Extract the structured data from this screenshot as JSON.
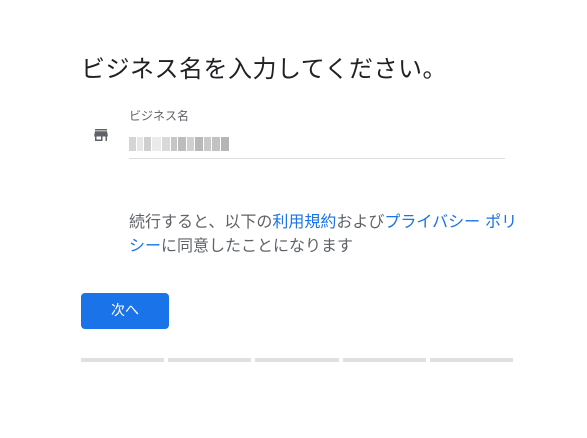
{
  "page": {
    "title": "ビジネス名を入力してください。"
  },
  "business_name_field": {
    "label": "ビジネス名",
    "icon": "store-icon"
  },
  "terms": {
    "prefix": "続行すると、以下の",
    "terms_link": "利用規約",
    "middle": "および",
    "privacy_link": "プライバシー ポリシー",
    "suffix": "に同意したことになります"
  },
  "actions": {
    "next_label": "次へ"
  },
  "progress": {
    "total_steps": 5,
    "completed_steps": 0
  },
  "colors": {
    "accent": "#1a73e8",
    "text_primary": "#202124",
    "text_secondary": "#5f6368",
    "divider": "#dadce0",
    "progress_track": "#e0e0e0"
  }
}
